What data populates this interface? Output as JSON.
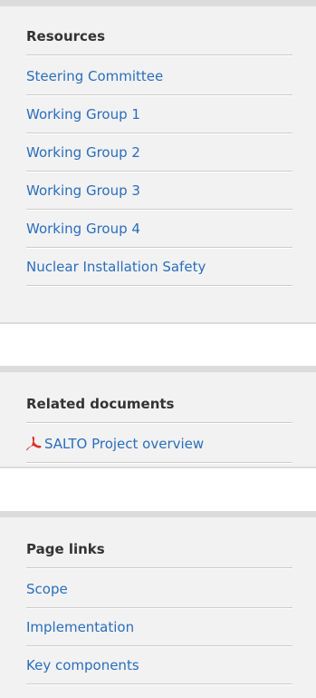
{
  "resources": {
    "title": "Resources",
    "items": [
      {
        "label": "Steering Committee"
      },
      {
        "label": "Working Group 1"
      },
      {
        "label": "Working Group 2"
      },
      {
        "label": "Working Group 3"
      },
      {
        "label": "Working Group 4"
      },
      {
        "label": "Nuclear Installation Safety"
      }
    ]
  },
  "related_documents": {
    "title": "Related documents",
    "items": [
      {
        "label": "SALTO Project overview",
        "icon": "pdf-icon"
      }
    ]
  },
  "page_links": {
    "title": "Page links",
    "items": [
      {
        "label": "Scope"
      },
      {
        "label": "Implementation"
      },
      {
        "label": "Key components"
      }
    ]
  },
  "colors": {
    "link": "#2a6ebb",
    "panel_background": "#f2f2f2",
    "panel_border": "#dcdcdc",
    "divider": "#cccccc",
    "title_text": "#333333",
    "pdf_icon": "#d9342b"
  }
}
